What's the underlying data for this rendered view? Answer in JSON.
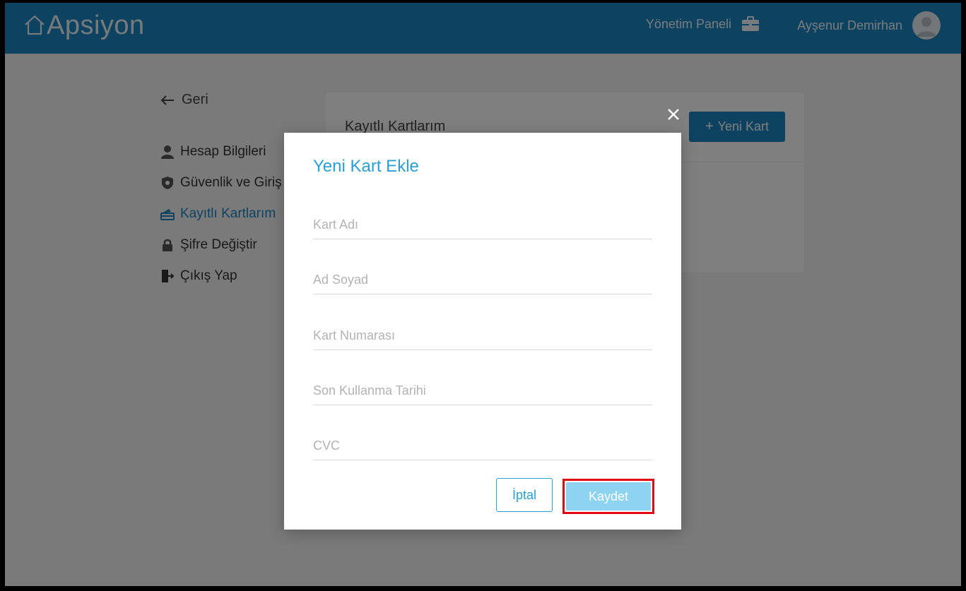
{
  "header": {
    "logo_text": "Apsiyon",
    "admin_panel_label": "Yönetim Paneli",
    "user_name": "Ayşenur Demirhan"
  },
  "sidebar": {
    "back_label": "Geri",
    "items": [
      {
        "label": "Hesap Bilgileri",
        "icon": "user-icon",
        "active": false
      },
      {
        "label": "Güvenlik ve Giriş",
        "icon": "shield-icon",
        "active": false
      },
      {
        "label": "Kayıtlı Kartlarım",
        "icon": "card-icon",
        "active": true
      },
      {
        "label": "Şifre Değiştir",
        "icon": "lock-icon",
        "active": false
      },
      {
        "label": "Çıkış Yap",
        "icon": "logout-icon",
        "active": false
      }
    ]
  },
  "cards_panel": {
    "title": "Kayıtlı Kartlarım",
    "new_card_label": "Yeni Kart"
  },
  "modal": {
    "title": "Yeni Kart Ekle",
    "fields": [
      {
        "placeholder": "Kart Adı",
        "value": ""
      },
      {
        "placeholder": "Ad Soyad",
        "value": ""
      },
      {
        "placeholder": "Kart Numarası",
        "value": ""
      },
      {
        "placeholder": "Son Kullanma Tarihi",
        "value": ""
      },
      {
        "placeholder": "CVC",
        "value": ""
      }
    ],
    "cancel_label": "İptal",
    "save_label": "Kaydet"
  },
  "colors": {
    "header_bg": "#1b85c0",
    "accent": "#2a9fd8",
    "save_button_bg": "#8fd3f3",
    "highlight_border": "#e30613"
  }
}
